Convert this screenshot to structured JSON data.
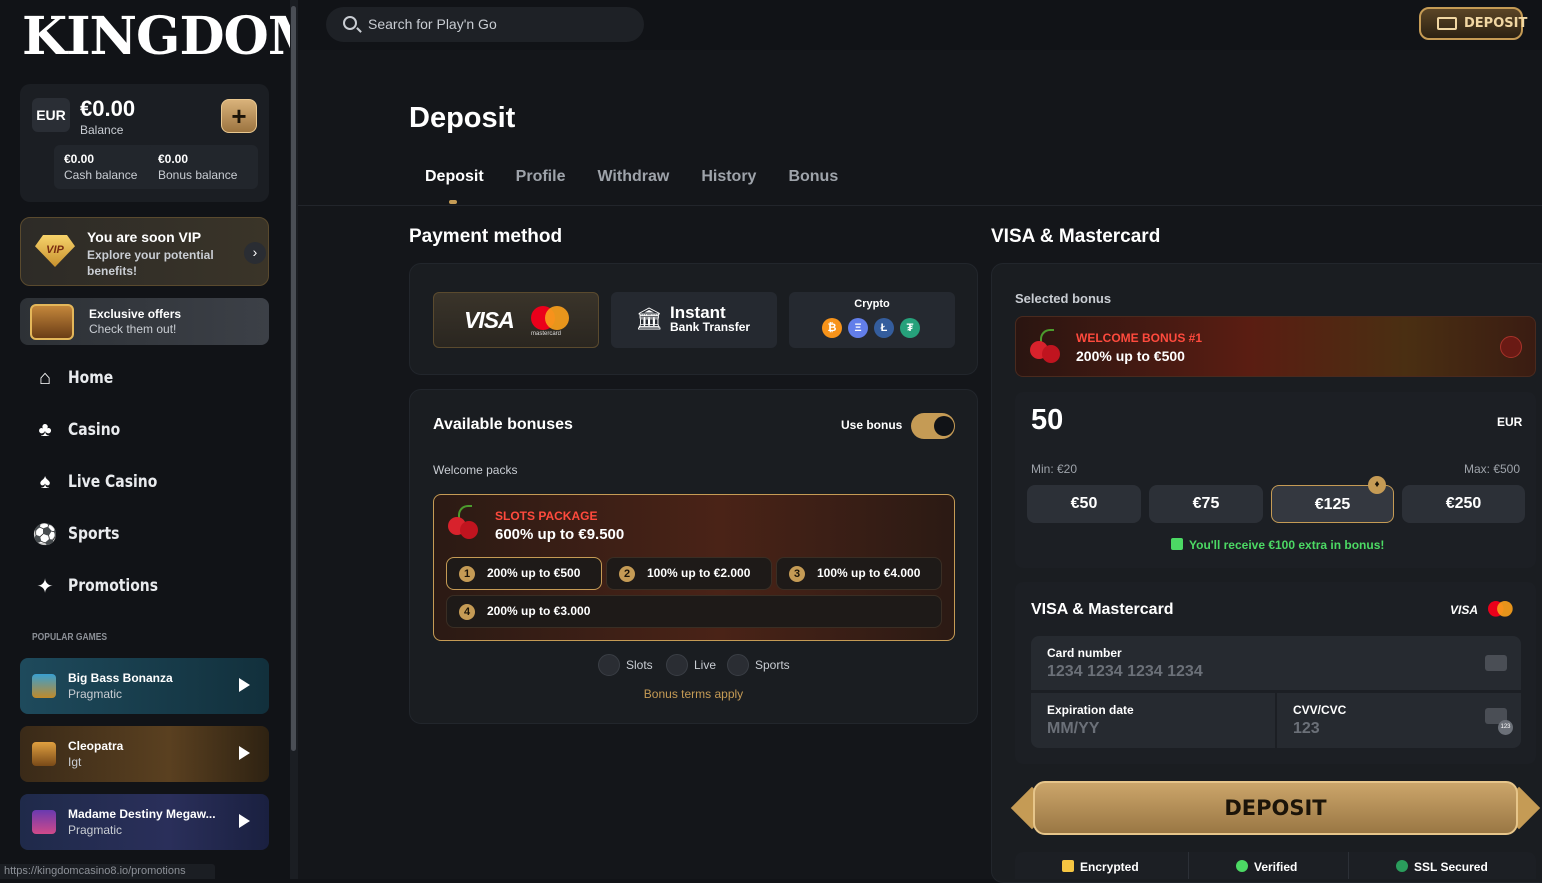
{
  "sidebar": {
    "logo": "KINGDOM",
    "balance": {
      "currency": "EUR",
      "amount": "€0.00",
      "label": "Balance",
      "add": "+",
      "cash_amount": "€0.00",
      "cash_label": "Cash balance",
      "bonus_amount": "€0.00",
      "bonus_label": "Bonus balance"
    },
    "vip": {
      "badge": "VIP",
      "title": "You are soon VIP",
      "subtitle": "Explore your potential benefits!"
    },
    "offers": {
      "title": "Exclusive offers",
      "subtitle": "Check them out!"
    },
    "nav": [
      {
        "label": "Home",
        "icon": "home-icon"
      },
      {
        "label": "Casino",
        "icon": "casino-icon"
      },
      {
        "label": "Live Casino",
        "icon": "live-casino-icon"
      },
      {
        "label": "Sports",
        "icon": "sports-icon"
      },
      {
        "label": "Promotions",
        "icon": "gift-icon"
      }
    ],
    "popular_title": "POPULAR GAMES",
    "games": [
      {
        "title": "Big Bass Bonanza",
        "provider": "Pragmatic"
      },
      {
        "title": "Cleopatra",
        "provider": "Igt"
      },
      {
        "title": "Madame Destiny Megaw...",
        "provider": "Pragmatic"
      }
    ],
    "status_url": "https://kingdomcasino8.io/promotions"
  },
  "header": {
    "search_placeholder": "Search for Play'n Go",
    "deposit_button": "DEPOSIT"
  },
  "page": {
    "title": "Deposit",
    "tabs": [
      "Deposit",
      "Profile",
      "Withdraw",
      "History",
      "Bonus"
    ],
    "active_tab": "Deposit"
  },
  "payment": {
    "heading": "Payment method",
    "methods": {
      "visa": "VISA",
      "mastercard_small": "mastercard",
      "instant_title": "Instant",
      "instant_sub": "Bank Transfer",
      "crypto": "Crypto",
      "coins": [
        "₿",
        "Ξ",
        "Ł",
        "₮"
      ]
    }
  },
  "bonuses": {
    "heading": "Available bonuses",
    "use_bonus_label": "Use bonus",
    "use_bonus": true,
    "section": "Welcome packs",
    "package": {
      "name": "SLOTS PACKAGE",
      "offer": "600% up to €9.500",
      "steps": [
        {
          "n": "1",
          "text": "200% up to €500"
        },
        {
          "n": "2",
          "text": "100% up to €2.000"
        },
        {
          "n": "3",
          "text": "100% up to €4.000"
        },
        {
          "n": "4",
          "text": "200% up to €3.000"
        }
      ]
    },
    "categories": [
      "Slots",
      "Live",
      "Sports"
    ],
    "terms": "Bonus terms apply"
  },
  "visa_panel": {
    "heading": "VISA & Mastercard",
    "selected_bonus_label": "Selected bonus",
    "selected_bonus": {
      "name": "WELCOME BONUS #1",
      "offer": "200% up to €500"
    },
    "amount": "50",
    "currency": "EUR",
    "min": "Min: €20",
    "max": "Max: €500",
    "presets": [
      "€50",
      "€75",
      "€125",
      "€250"
    ],
    "hot_preset": "€125",
    "extra_note": "You'll receive €100 extra in bonus!",
    "card": {
      "title": "VISA & Mastercard",
      "visa_logo": "VISA",
      "number_label": "Card number",
      "number_placeholder": "1234 1234 1234 1234",
      "expiry_label": "Expiration date",
      "expiry_placeholder": "MM/YY",
      "cvv_label": "CVV/CVC",
      "cvv_placeholder": "123",
      "cvv_icon_badge": "123"
    },
    "deposit_button": "DEPOSIT",
    "trust": [
      "Encrypted",
      "Verified",
      "SSL Secured"
    ]
  },
  "colors": {
    "accent": "#c59b55",
    "bonus_red": "#ff4a3d",
    "success_green": "#4cd964"
  }
}
